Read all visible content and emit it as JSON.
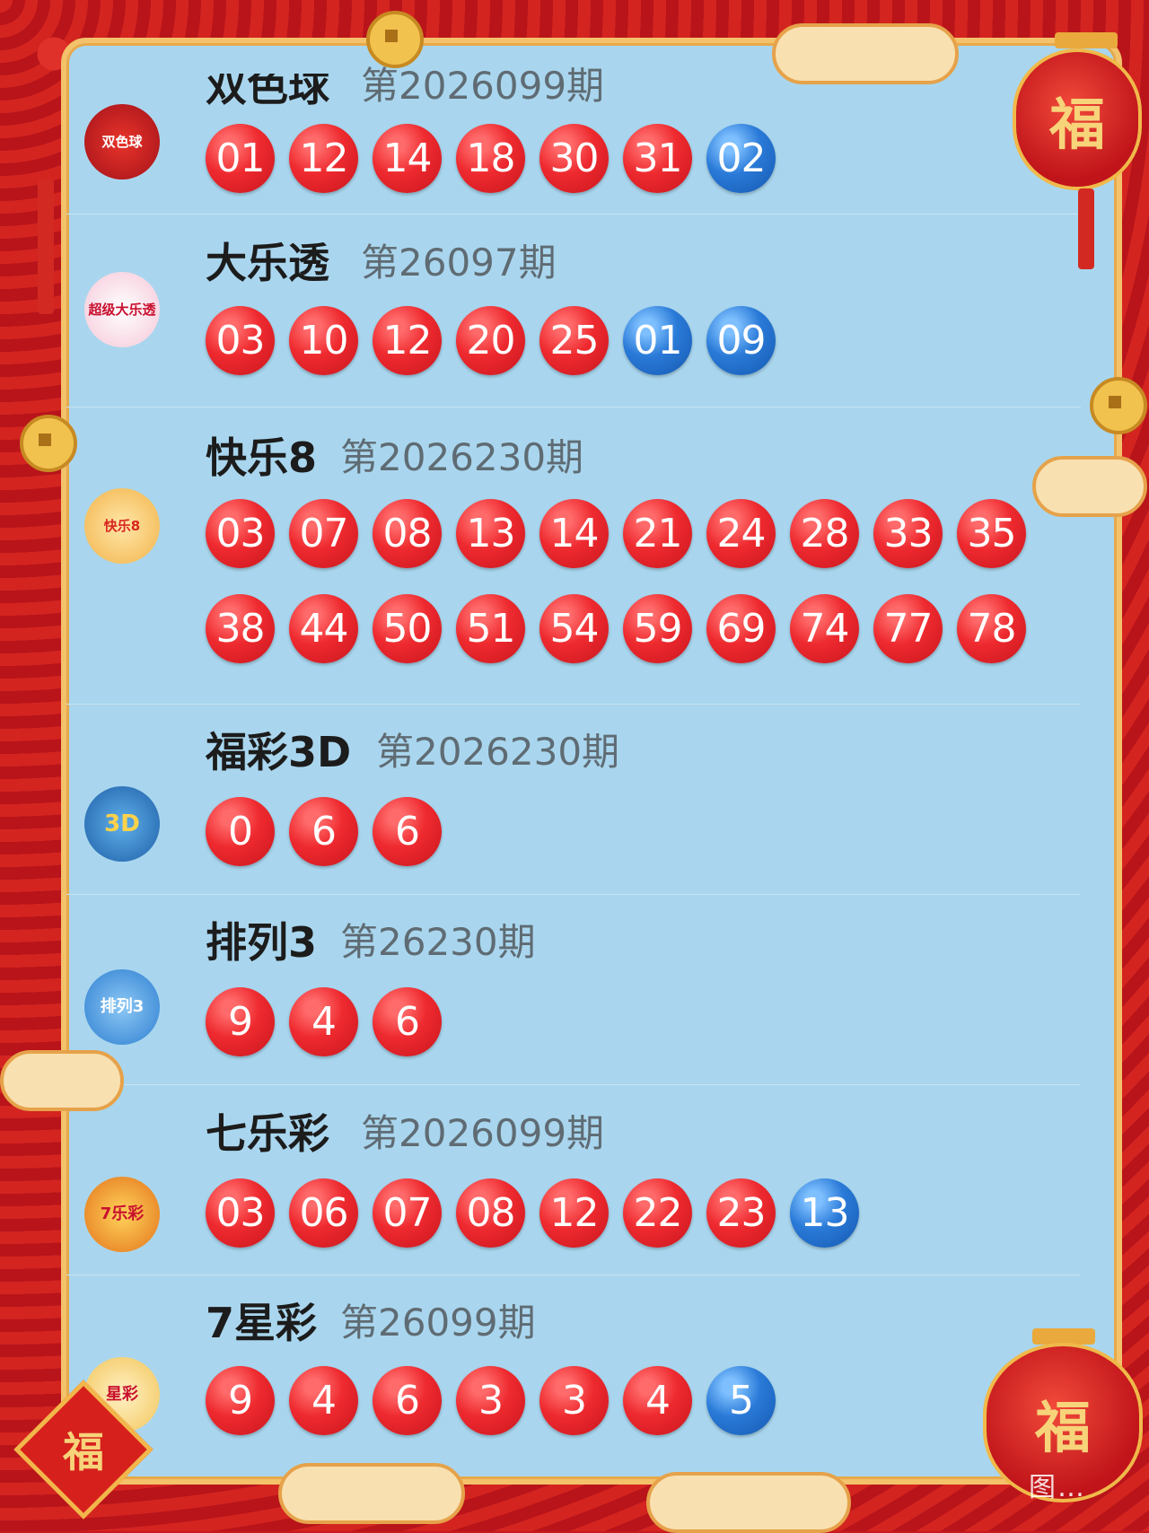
{
  "decor": {
    "lantern_char": "福",
    "knot_char": "福",
    "watermark": "图…"
  },
  "sections": [
    {
      "id": "ssq",
      "logo": "双色球",
      "title": "双色球",
      "period": "第2026099期",
      "balls": [
        {
          "n": "01",
          "c": "red"
        },
        {
          "n": "12",
          "c": "red"
        },
        {
          "n": "14",
          "c": "red"
        },
        {
          "n": "18",
          "c": "red"
        },
        {
          "n": "30",
          "c": "red"
        },
        {
          "n": "31",
          "c": "red"
        },
        {
          "n": "02",
          "c": "blue"
        }
      ]
    },
    {
      "id": "dlt",
      "logo": "超级大乐透",
      "title": "大乐透",
      "period": "第26097期",
      "balls": [
        {
          "n": "03",
          "c": "red"
        },
        {
          "n": "10",
          "c": "red"
        },
        {
          "n": "12",
          "c": "red"
        },
        {
          "n": "20",
          "c": "red"
        },
        {
          "n": "25",
          "c": "red"
        },
        {
          "n": "01",
          "c": "blue"
        },
        {
          "n": "09",
          "c": "blue"
        }
      ]
    },
    {
      "id": "kl8",
      "logo": "快乐8",
      "title": "快乐8",
      "period": "第2026230期",
      "balls": [
        {
          "n": "03",
          "c": "red"
        },
        {
          "n": "07",
          "c": "red"
        },
        {
          "n": "08",
          "c": "red"
        },
        {
          "n": "13",
          "c": "red"
        },
        {
          "n": "14",
          "c": "red"
        },
        {
          "n": "21",
          "c": "red"
        },
        {
          "n": "24",
          "c": "red"
        },
        {
          "n": "28",
          "c": "red"
        },
        {
          "n": "33",
          "c": "red"
        },
        {
          "n": "35",
          "c": "red"
        }
      ],
      "balls2": [
        {
          "n": "38",
          "c": "red"
        },
        {
          "n": "44",
          "c": "red"
        },
        {
          "n": "50",
          "c": "red"
        },
        {
          "n": "51",
          "c": "red"
        },
        {
          "n": "54",
          "c": "red"
        },
        {
          "n": "59",
          "c": "red"
        },
        {
          "n": "69",
          "c": "red"
        },
        {
          "n": "74",
          "c": "red"
        },
        {
          "n": "77",
          "c": "red"
        },
        {
          "n": "78",
          "c": "red"
        }
      ]
    },
    {
      "id": "fc3d",
      "logo": "3D",
      "title": "福彩3D",
      "period": "第2026230期",
      "balls": [
        {
          "n": "0",
          "c": "red"
        },
        {
          "n": "6",
          "c": "red"
        },
        {
          "n": "6",
          "c": "red"
        }
      ]
    },
    {
      "id": "pl3",
      "logo": "排列3",
      "title": "排列3",
      "period": "第26230期",
      "balls": [
        {
          "n": "9",
          "c": "red"
        },
        {
          "n": "4",
          "c": "red"
        },
        {
          "n": "6",
          "c": "red"
        }
      ]
    },
    {
      "id": "qlc",
      "logo": "7乐彩",
      "title": "七乐彩",
      "period": "第2026099期",
      "balls": [
        {
          "n": "03",
          "c": "red"
        },
        {
          "n": "06",
          "c": "red"
        },
        {
          "n": "07",
          "c": "red"
        },
        {
          "n": "08",
          "c": "red"
        },
        {
          "n": "12",
          "c": "red"
        },
        {
          "n": "22",
          "c": "red"
        },
        {
          "n": "23",
          "c": "red"
        },
        {
          "n": "13",
          "c": "blue"
        }
      ]
    },
    {
      "id": "qxc",
      "logo": "星彩",
      "title": "7星彩",
      "period": "第26099期",
      "balls": [
        {
          "n": "9",
          "c": "red"
        },
        {
          "n": "4",
          "c": "red"
        },
        {
          "n": "6",
          "c": "red"
        },
        {
          "n": "3",
          "c": "red"
        },
        {
          "n": "3",
          "c": "red"
        },
        {
          "n": "4",
          "c": "red"
        },
        {
          "n": "5",
          "c": "blue"
        }
      ]
    }
  ]
}
